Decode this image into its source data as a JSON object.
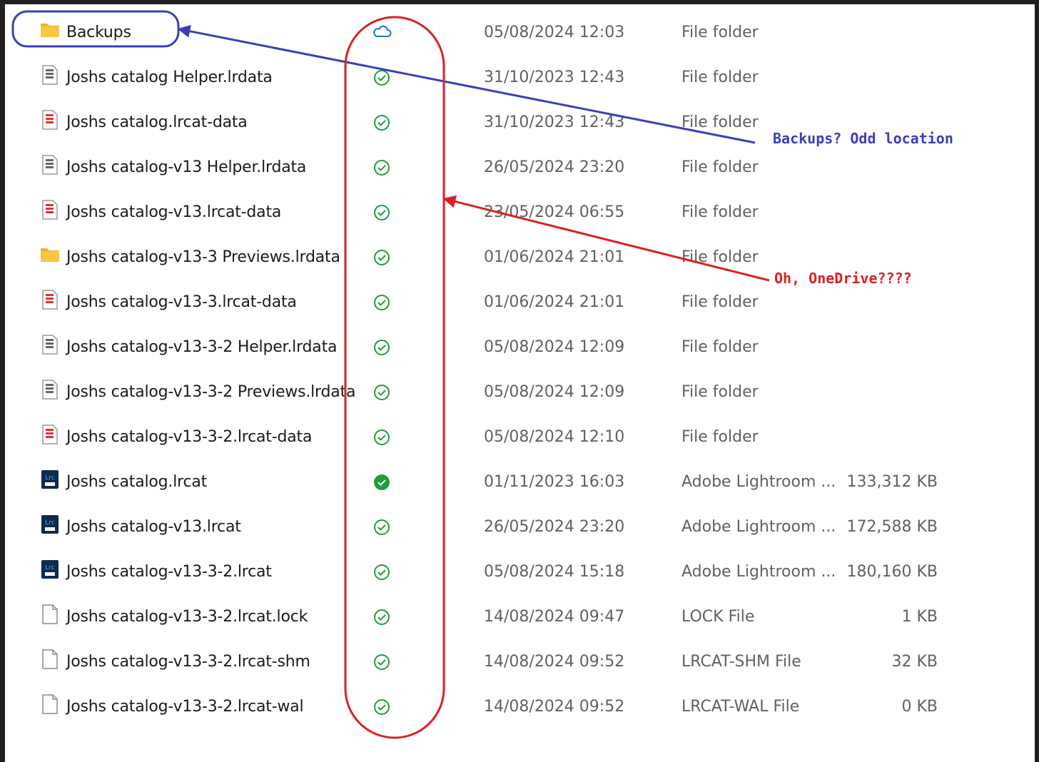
{
  "files": [
    {
      "name": "Backups",
      "date": "05/08/2024 12:03",
      "type": "File folder",
      "size": "",
      "icon": "folder-icon",
      "status": "cloud-icon"
    },
    {
      "name": "Joshs catalog Helper.lrdata",
      "date": "31/10/2023 12:43",
      "type": "File folder",
      "size": "",
      "icon": "lrdata-icon",
      "status": "available-icon"
    },
    {
      "name": "Joshs catalog.lrcat-data",
      "date": "31/10/2023 12:43",
      "type": "File folder",
      "size": "",
      "icon": "lrcat-data-icon",
      "status": "available-icon"
    },
    {
      "name": "Joshs catalog-v13 Helper.lrdata",
      "date": "26/05/2024 23:20",
      "type": "File folder",
      "size": "",
      "icon": "lrdata-icon",
      "status": "available-icon"
    },
    {
      "name": "Joshs catalog-v13.lrcat-data",
      "date": "23/05/2024 06:55",
      "type": "File folder",
      "size": "",
      "icon": "lrcat-data-icon",
      "status": "available-icon"
    },
    {
      "name": "Joshs catalog-v13-3 Previews.lrdata",
      "date": "01/06/2024 21:01",
      "type": "File folder",
      "size": "",
      "icon": "folder-icon",
      "status": "available-icon"
    },
    {
      "name": "Joshs catalog-v13-3.lrcat-data",
      "date": "01/06/2024 21:01",
      "type": "File folder",
      "size": "",
      "icon": "lrcat-data-icon",
      "status": "available-icon"
    },
    {
      "name": "Joshs catalog-v13-3-2 Helper.lrdata",
      "date": "05/08/2024 12:09",
      "type": "File folder",
      "size": "",
      "icon": "lrdata-icon",
      "status": "available-icon"
    },
    {
      "name": "Joshs catalog-v13-3-2 Previews.lrdata",
      "date": "05/08/2024 12:09",
      "type": "File folder",
      "size": "",
      "icon": "lrdata-icon",
      "status": "available-icon"
    },
    {
      "name": "Joshs catalog-v13-3-2.lrcat-data",
      "date": "05/08/2024 12:10",
      "type": "File folder",
      "size": "",
      "icon": "lrcat-data-icon",
      "status": "available-icon"
    },
    {
      "name": "Joshs catalog.lrcat",
      "date": "01/11/2023 16:03",
      "type": "Adobe Lightroom ...",
      "size": "133,312 KB",
      "icon": "lightroom-catalog-icon",
      "status": "always-available-icon"
    },
    {
      "name": "Joshs catalog-v13.lrcat",
      "date": "26/05/2024 23:20",
      "type": "Adobe Lightroom ...",
      "size": "172,588 KB",
      "icon": "lightroom-catalog-icon",
      "status": "available-icon"
    },
    {
      "name": "Joshs catalog-v13-3-2.lrcat",
      "date": "05/08/2024 15:18",
      "type": "Adobe Lightroom ...",
      "size": "180,160 KB",
      "icon": "lightroom-catalog-icon",
      "status": "available-icon"
    },
    {
      "name": "Joshs catalog-v13-3-2.lrcat.lock",
      "date": "14/08/2024 09:47",
      "type": "LOCK File",
      "size": "1 KB",
      "icon": "generic-file-icon",
      "status": "available-icon"
    },
    {
      "name": "Joshs catalog-v13-3-2.lrcat-shm",
      "date": "14/08/2024 09:52",
      "type": "LRCAT-SHM File",
      "size": "32 KB",
      "icon": "generic-file-icon",
      "status": "available-icon"
    },
    {
      "name": "Joshs catalog-v13-3-2.lrcat-wal",
      "date": "14/08/2024 09:52",
      "type": "LRCAT-WAL File",
      "size": "0 KB",
      "icon": "generic-file-icon",
      "status": "available-icon"
    }
  ],
  "annotations": {
    "blue_text": "Backups? Odd location",
    "red_text": "Oh, OneDrive????",
    "blue_color": "#3b3fb5",
    "red_color": "#d92127"
  },
  "colors": {
    "folder": "#f3c343",
    "status_green": "#1e9e3a",
    "cloud_blue": "#1a73c9"
  }
}
